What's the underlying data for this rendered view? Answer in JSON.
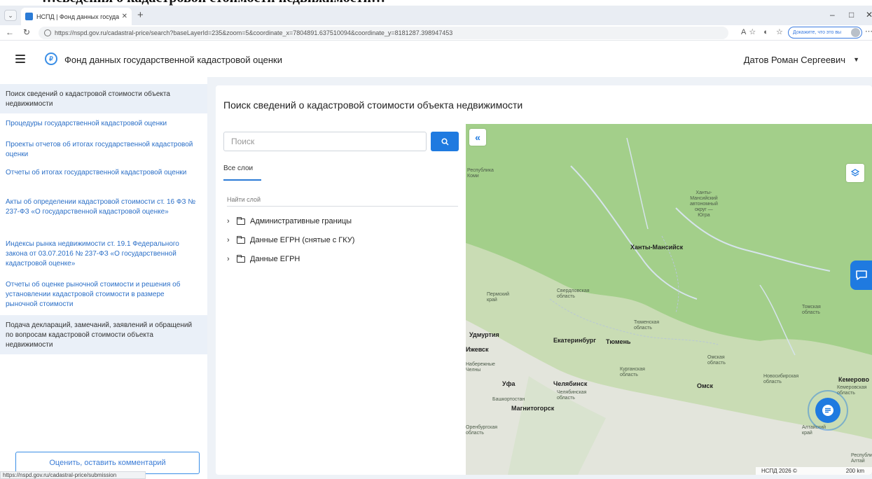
{
  "banner": {
    "text": "…сведения о кадастровой стоимости недвижимости…"
  },
  "browser": {
    "tab_title": "НСПД | Фонд данных государстве…",
    "url": "https://nspd.gov.ru/cadastral-price/search?baseLayerId=235&zoom=5&coordinate_x=7804891.637510094&coordinate_y=8181287.398947453",
    "prove_button": "Докажите, что это вы",
    "status_url": "https://nspd.gov.ru/cadastral-price/submission"
  },
  "header": {
    "title": "Фонд данных государственной кадастровой оценки",
    "user": "Датов Роман Сергеевич"
  },
  "sidebar": {
    "items": [
      {
        "label": "Поиск сведений о кадастровой стоимости объекта недвижимости"
      },
      {
        "label": "Процедуры государственной кадастровой оценки"
      },
      {
        "label": "Проекты отчетов об итогах государственной кадастровой оценки"
      },
      {
        "label": "Отчеты об итогах государственной кадастровой оценки"
      },
      {
        "label": "Акты об определении кадастровой стоимости ст. 16 ФЗ № 237-ФЗ «О государственной кадастровой оценке»"
      },
      {
        "label": "Индексы рынка недвижимости ст. 19.1 Федерального закона от 03.07.2016 № 237-ФЗ «О государственной кадастровой оценке»"
      },
      {
        "label": "Отчеты об оценке рыночной стоимости и решения об установлении кадастровой стоимости в размере рыночной стоимости"
      },
      {
        "label": "Подача деклараций, замечаний, заявлений и обращений по вопросам кадастровой стоимости объекта недвижимости"
      }
    ],
    "feedback_button": "Оценить, оставить комментарий"
  },
  "main": {
    "title": "Поиск сведений о кадастровой стоимости объекта недвижимости",
    "search_placeholder": "Поиск",
    "tab_all_layers": "Все слои",
    "find_layer": "Найти слой",
    "tree": [
      {
        "label": "Административные границы"
      },
      {
        "label": "Данные ЕГРН (снятые с ГКУ)"
      },
      {
        "label": "Данные ЕГРН"
      }
    ]
  },
  "map": {
    "labels": {
      "khmao": "Ханты-\nМансийский\nавтономный\nокруг —\nЮгра",
      "khanty": "Ханты-Мансийск",
      "perm": "Пермский\nкрай",
      "sverdl": "Свердловская\nобласть",
      "tomsk": "Томская\nобласть",
      "tyumen_reg": "Тюменская\nобласть",
      "ekb": "Екатеринбург",
      "tyumen": "Тюмень",
      "izhevsk": "Ижевск",
      "udm": "Удмуртия",
      "chelny": "Набережные\nЧелны",
      "omsk_reg": "Омская\nобласть",
      "kurgan": "Курганская\nобласть",
      "ufa": "Уфа",
      "chelyabinsk": "Челябинск",
      "omsk": "Омск",
      "chel_reg": "Челябинская\nобласть",
      "bashk": "Башкортостан",
      "magn": "Магнитогорск",
      "nsk_reg": "Новосибирская\nобласть",
      "kemerovo": "Кемерово",
      "kem_reg": "Кемеровская\nобласть",
      "orenb": "Оренбургская\nобласть",
      "altai": "Алтайский\nкрай",
      "rep_altai": "Республика\nАлтай",
      "komi": "Республика\nКоми"
    },
    "attribution": "НСПД 2026 ©",
    "scale": "200 km"
  }
}
